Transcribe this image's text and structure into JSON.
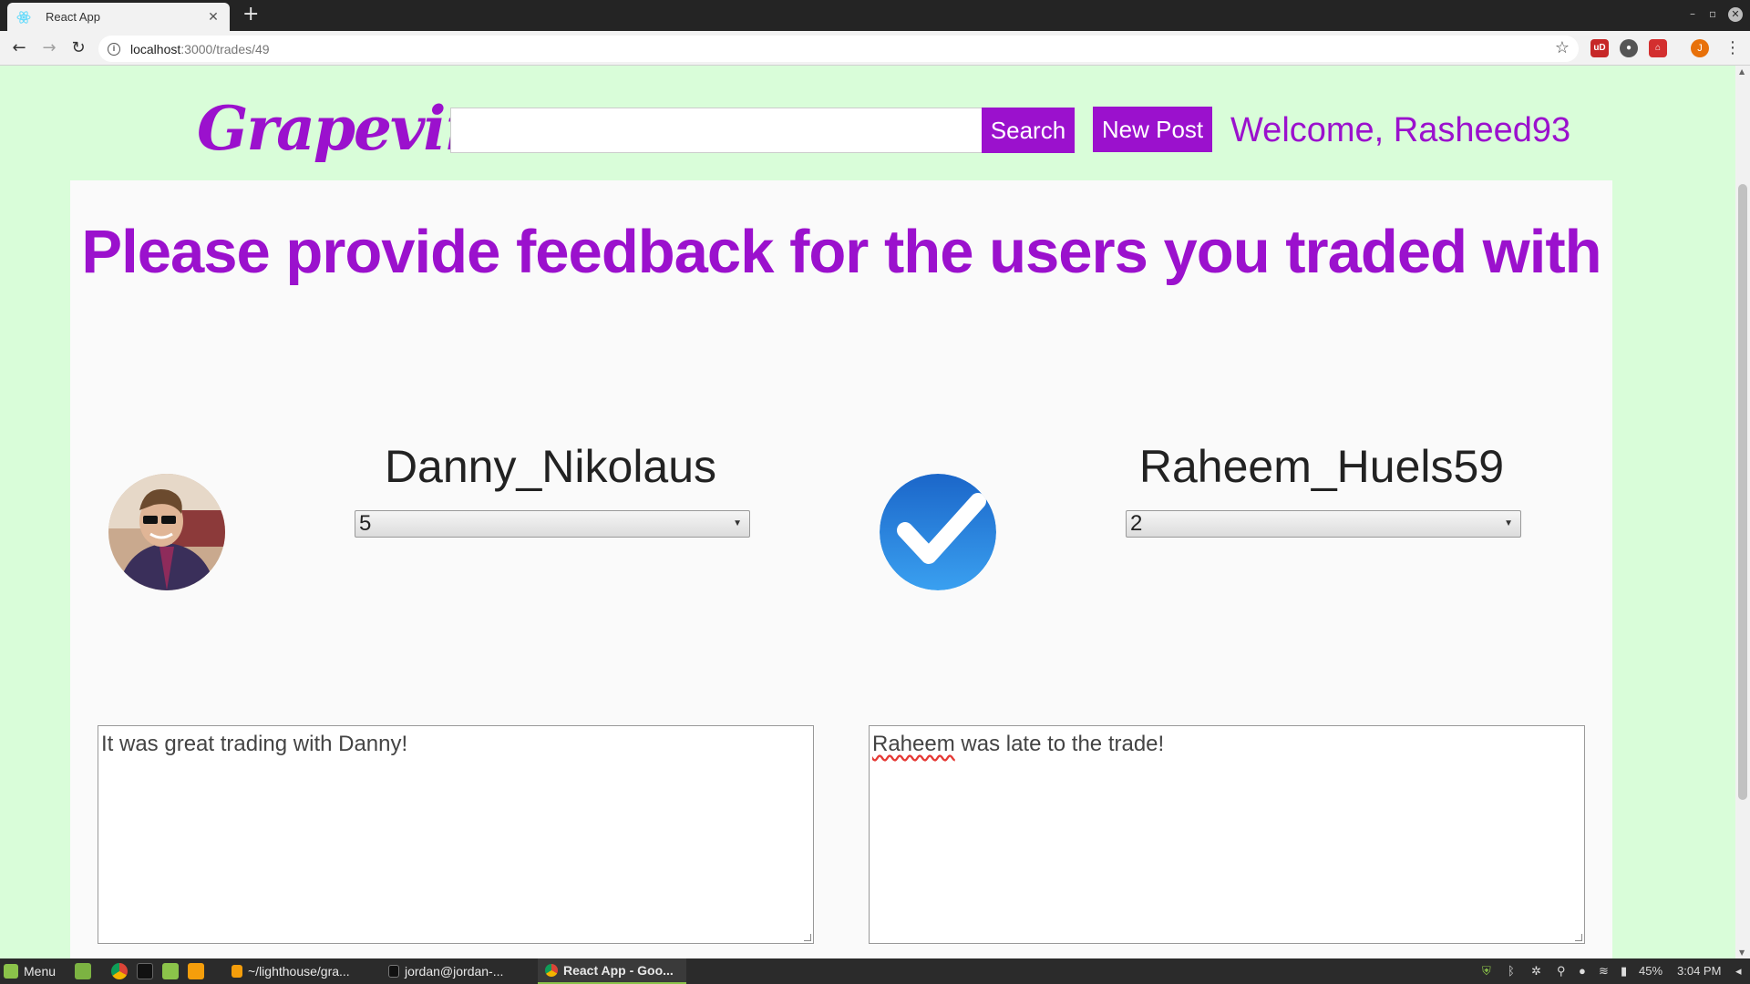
{
  "browser": {
    "tab_title": "React App",
    "tab_close": "✕",
    "new_tab": "+",
    "url_host": "localhost",
    "url_path": ":3000/trades/49",
    "back": "←",
    "forward": "→",
    "reload": "↻",
    "star": "☆",
    "profile_initial": "J",
    "menu": "⋮",
    "window_controls": {
      "minimize": "–",
      "restore": "▫",
      "close": "✕"
    },
    "extensions": [
      {
        "name": "ublock-icon",
        "label": "uD",
        "color": "#c62828"
      },
      {
        "name": "ghostery-icon",
        "label": "●",
        "color": "#555555"
      },
      {
        "name": "extension-red-icon",
        "label": "⌂",
        "color": "#d32f2f"
      }
    ]
  },
  "header": {
    "logo": "Grapevine",
    "search_placeholder": "",
    "search_label": "Search",
    "new_post_label": "New Post",
    "welcome": "Welcome, Rasheed93"
  },
  "feedback": {
    "heading": "Please provide feedback for the users you traded with",
    "users": [
      {
        "username": "Danny_Nikolaus",
        "rating": "5",
        "comment": "It was great trading with Danny!"
      },
      {
        "username": "Raheem_Huels59",
        "rating": "2",
        "comment_first": "Raheem",
        "comment_rest": " was late to the trade!"
      }
    ]
  },
  "taskbar": {
    "menu_label": "Menu",
    "windows": [
      {
        "label": "~/lighthouse/gra..."
      },
      {
        "label": "jordan@jordan-..."
      },
      {
        "label": "React App - Goo..."
      }
    ],
    "battery": "45%",
    "clock": "3:04 PM"
  },
  "colors": {
    "brand": "#9b11cd",
    "page_bg": "#d9fdd9",
    "card_bg": "#fafafa"
  }
}
